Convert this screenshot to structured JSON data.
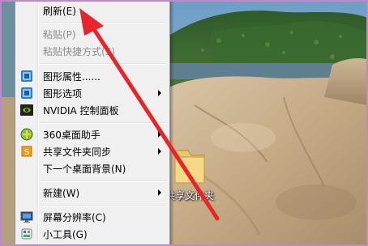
{
  "context_menu": {
    "items": [
      {
        "label": "刷新(E)",
        "enabled": true,
        "icon": null,
        "submenu": false
      },
      {
        "label": "粘贴(P)",
        "enabled": false,
        "icon": null,
        "submenu": false
      },
      {
        "label": "粘贴快捷方式(S)",
        "enabled": false,
        "icon": null,
        "submenu": false
      },
      {
        "label": "图形属性......",
        "enabled": true,
        "icon": "intel-graphics-icon",
        "submenu": false
      },
      {
        "label": "图形选项",
        "enabled": true,
        "icon": "intel-graphics-icon",
        "submenu": true
      },
      {
        "label": "NVIDIA 控制面板",
        "enabled": true,
        "icon": "nvidia-icon",
        "submenu": false
      },
      {
        "label": "360桌面助手",
        "enabled": true,
        "icon": "360-icon",
        "submenu": true
      },
      {
        "label": "共享文件夹同步",
        "enabled": true,
        "icon": "sync-icon",
        "submenu": true
      },
      {
        "label": "下一个桌面背景(N)",
        "enabled": true,
        "icon": null,
        "submenu": false
      },
      {
        "label": "新建(W)",
        "enabled": true,
        "icon": null,
        "submenu": true
      },
      {
        "label": "屏幕分辨率(C)",
        "enabled": true,
        "icon": "monitor-icon",
        "submenu": false
      },
      {
        "label": "小工具(G)",
        "enabled": true,
        "icon": "gadgets-icon",
        "submenu": false
      }
    ]
  },
  "desktop": {
    "folder_label": "共享文件夹"
  },
  "colors": {
    "menu_bg": "#f0f0f0",
    "disabled_text": "#8d8d8d",
    "arrow_red": "#e8262a",
    "frame": "#b98bc8"
  }
}
